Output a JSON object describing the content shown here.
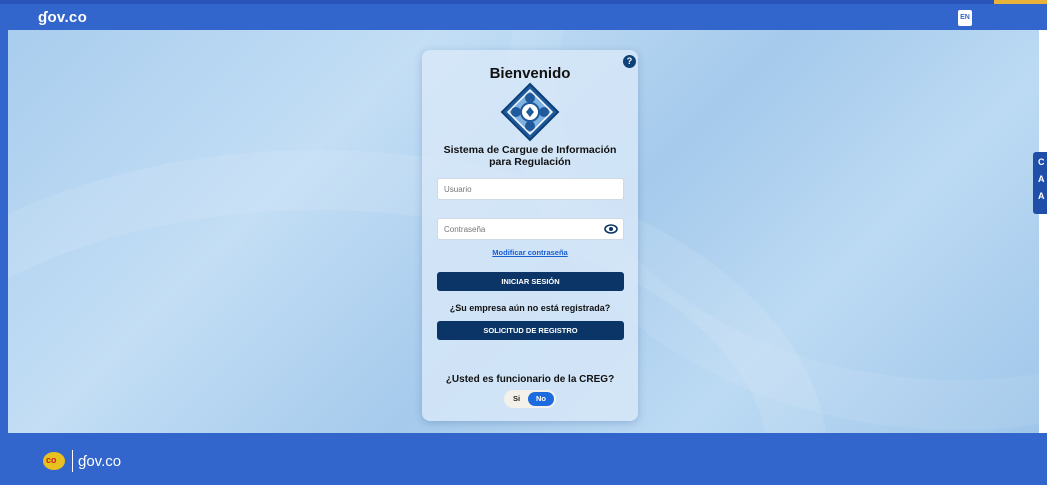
{
  "header": {
    "logo_text": "ɠov.co",
    "lang_button": "EN"
  },
  "login": {
    "help_label": "?",
    "title": "Bienvenido",
    "subtitle_line1": "Sistema de Cargue de Información",
    "subtitle_line2": "para Regulación",
    "username_placeholder": "Usuario",
    "username_value": "",
    "password_placeholder": "Contraseña",
    "password_value": "",
    "modify_password_link": "Modificar contraseña",
    "login_button": "INICIAR SESIÓN",
    "register_question": "¿Su empresa aún no está registrada?",
    "register_button": "SOLICITUD DE REGISTRO",
    "official_question": "¿Usted es funcionario de la CREG?",
    "toggle": {
      "option_yes": "Si",
      "option_no": "No",
      "selected": "No"
    }
  },
  "accessibility_tab": {
    "items": [
      "C",
      "A",
      "A"
    ]
  },
  "footer": {
    "co_badge": "co",
    "logo_text": "ɠov.co"
  },
  "colors": {
    "brand_blue": "#3366cc",
    "button_navy": "#0b3566",
    "toggle_active": "#1c6ce0",
    "link_blue": "#1a5fd0"
  },
  "icons": {
    "help": "question-mark-icon",
    "emblem": "energy-gas-emblem-icon",
    "eye": "eye-icon"
  }
}
